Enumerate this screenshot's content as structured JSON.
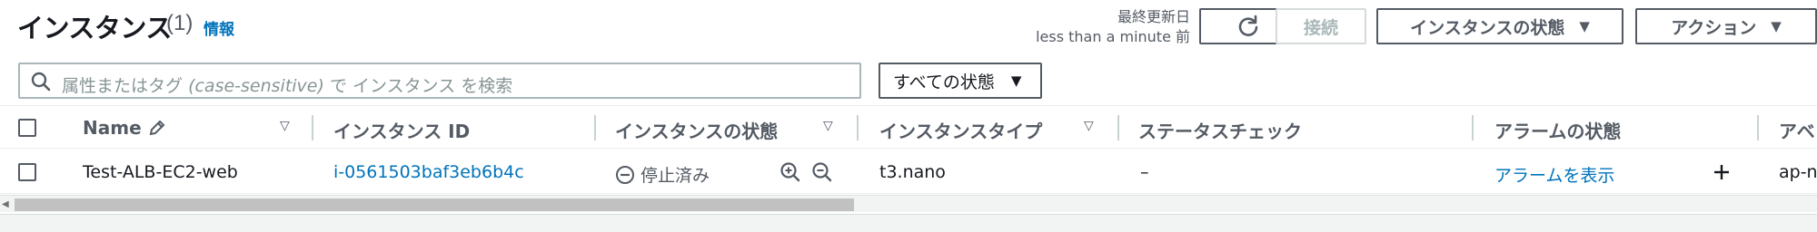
{
  "header": {
    "title": "インスタンス",
    "count": "(1)",
    "info_link": "情報",
    "last_updated_label": "最終更新日",
    "last_updated_value": "less than a minute 前",
    "connect_label": "接続",
    "instance_state_label": "インスタンスの状態",
    "actions_label": "アクション"
  },
  "search": {
    "placeholder_prefix": "属性またはタグ",
    "placeholder_en": "(case-sensitive)",
    "placeholder_suffix": "で インスタンス を検索"
  },
  "filter": {
    "selected": "すべての状態"
  },
  "table": {
    "columns": [
      "Name",
      "インスタンス ID",
      "インスタンスの状態",
      "インスタンスタイプ",
      "ステータスチェック",
      "アラームの状態",
      "アベ"
    ],
    "rows": [
      {
        "name": "Test-ALB-EC2-web",
        "instance_id": "i-0561503baf3eb6b4c",
        "state": "停止済み",
        "instance_type": "t3.nano",
        "status_check": "–",
        "alarm": "アラームを表示",
        "az": "ap-n"
      }
    ]
  },
  "colors": {
    "link": "#0073bb",
    "text": "#16191f",
    "muted": "#545b64"
  }
}
